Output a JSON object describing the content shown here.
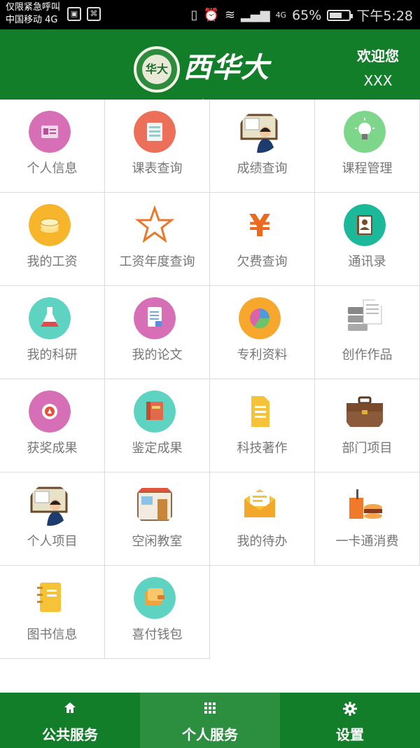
{
  "status_bar": {
    "line1": "仅限紧急呼叫",
    "line2": "中国移动 4G",
    "network": "4G",
    "battery_percent": "65%",
    "time": "下午5:28"
  },
  "header": {
    "seal_text": "华大",
    "university_name": "西华大学",
    "welcome": "欢迎您",
    "username": "XXX"
  },
  "grid_items": [
    {
      "label": "个人信息",
      "icon": "id-card-icon",
      "color": "#d66fb5"
    },
    {
      "label": "课表查询",
      "icon": "list-icon",
      "color": "#ec6f5a"
    },
    {
      "label": "成绩查询",
      "icon": "teacher-board-icon",
      "color": "#ffffff"
    },
    {
      "label": "课程管理",
      "icon": "lightbulb-icon",
      "color": "#7ed68a"
    },
    {
      "label": "我的工资",
      "icon": "coins-icon",
      "color": "#f7b52c"
    },
    {
      "label": "工资年度查询",
      "icon": "star-icon",
      "color": "#ffffff"
    },
    {
      "label": "欠费查询",
      "icon": "yen-icon",
      "color": "#ffffff"
    },
    {
      "label": "通讯录",
      "icon": "contacts-book-icon",
      "color": "#1bb89a"
    },
    {
      "label": "我的科研",
      "icon": "flask-icon",
      "color": "#5fd3c2"
    },
    {
      "label": "我的论文",
      "icon": "document-icon",
      "color": "#d66fb5"
    },
    {
      "label": "专利资料",
      "icon": "pie-chart-icon",
      "color": "#f7a82c"
    },
    {
      "label": "创作作品",
      "icon": "server-document-icon",
      "color": "#ffffff"
    },
    {
      "label": "获奖成果",
      "icon": "medal-icon",
      "color": "#d66fb5"
    },
    {
      "label": "鉴定成果",
      "icon": "book-icon",
      "color": "#5fd3c2"
    },
    {
      "label": "科技著作",
      "icon": "paper-icon",
      "color": "#ffffff"
    },
    {
      "label": "部门项目",
      "icon": "briefcase-icon",
      "color": "#ffffff"
    },
    {
      "label": "个人项目",
      "icon": "teacher-board-icon",
      "color": "#ffffff"
    },
    {
      "label": "空闲教室",
      "icon": "classroom-icon",
      "color": "#ffffff"
    },
    {
      "label": "我的待办",
      "icon": "envelope-icon",
      "color": "#ffffff"
    },
    {
      "label": "一卡通消费",
      "icon": "food-drink-icon",
      "color": "#ffffff"
    },
    {
      "label": "图书信息",
      "icon": "notebook-icon",
      "color": "#ffffff"
    },
    {
      "label": "喜付钱包",
      "icon": "wallet-icon",
      "color": "#5fd3c2"
    }
  ],
  "bottom_nav": [
    {
      "label": "公共服务",
      "icon": "home-icon",
      "active": false
    },
    {
      "label": "个人服务",
      "icon": "grid-icon",
      "active": true
    },
    {
      "label": "设置",
      "icon": "gear-icon",
      "active": false
    }
  ],
  "colors": {
    "brand_green": "#137e2a",
    "nav_active": "#2c8f3f",
    "label_gray": "#767676"
  }
}
